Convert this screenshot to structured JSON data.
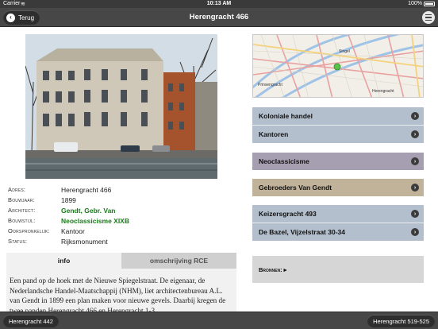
{
  "status_bar": {
    "carrier": "Carrier",
    "time": "10:13 AM",
    "battery": "100%"
  },
  "nav": {
    "back_label": "Terug",
    "title": "Herengracht 466"
  },
  "details": [
    {
      "label": "Adres:",
      "value": "Herengracht 466",
      "link": false
    },
    {
      "label": "Bouwjaar:",
      "value": "1899",
      "link": false
    },
    {
      "label": "Architect:",
      "value": "Gendt, Gebr. Van",
      "link": true
    },
    {
      "label": "Bouwstijl:",
      "value": "Neoclassicisme XIXB",
      "link": true
    },
    {
      "label": "Oorspronkelijk:",
      "value": "Kantoor",
      "link": false
    },
    {
      "label": "Status:",
      "value": "Rijksmonument",
      "link": false
    }
  ],
  "tabs": {
    "info": "info",
    "rce": "omschrijving RCE"
  },
  "description": "Een pand op de hoek met de Nieuwe Spiegelstraat. De eigenaar, de Nederlandsche Handel-Maatschappij (NHM), liet architectenbureau A.L. van Gendt in 1899 een plan maken voor nieuwe gevels. Daarbij kregen de twee panden Herengracht 466 en Herengracht 1-3",
  "map": {
    "labels": [
      "Singel",
      "Prinsengracht",
      "Herengracht"
    ]
  },
  "links": {
    "koloniale": "Koloniale handel",
    "kantoren": "Kantoren",
    "neoclassicisme": "Neoclassicisme",
    "gebroeders": "Gebroeders Van Gendt",
    "keizersgracht": "Keizersgracht 493",
    "debazel": "De Bazel, Vijzelstraat 30-34"
  },
  "bronnen": "Bronnen: ▸",
  "bottom": {
    "prev": "Herengracht 442",
    "next": "Herengracht 519-525"
  },
  "colors": {
    "link_green": "#1a7a1a",
    "blue_group": "#b3bfcc",
    "purple_group": "#a69fb2",
    "tan_group": "#c0b39a",
    "bar_dark": "#474747"
  }
}
